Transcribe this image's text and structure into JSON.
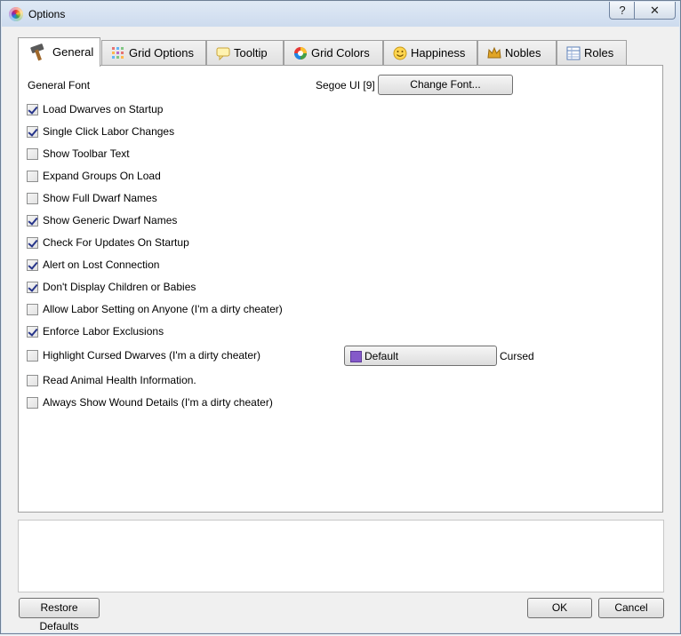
{
  "window": {
    "title": "Options",
    "help_glyph": "?",
    "close_glyph": "✕"
  },
  "tabs": [
    {
      "label": "General",
      "icon": "hammer-icon"
    },
    {
      "label": "Grid Options",
      "icon": "grid-dots-icon"
    },
    {
      "label": "Tooltip",
      "icon": "tooltip-icon"
    },
    {
      "label": "Grid Colors",
      "icon": "color-wheel-icon"
    },
    {
      "label": "Happiness",
      "icon": "smiley-icon"
    },
    {
      "label": "Nobles",
      "icon": "crown-icon"
    },
    {
      "label": "Roles",
      "icon": "table-icon"
    }
  ],
  "general": {
    "font_label": "General Font",
    "font_value": "Segoe UI [9]",
    "change_font_label": "Change Font...",
    "options": [
      {
        "label": "Load Dwarves on Startup",
        "checked": true
      },
      {
        "label": "Single Click Labor Changes",
        "checked": true
      },
      {
        "label": "Show Toolbar Text",
        "checked": false
      },
      {
        "label": "Expand Groups On Load",
        "checked": false
      },
      {
        "label": "Show Full Dwarf Names",
        "checked": false
      },
      {
        "label": "Show Generic Dwarf Names",
        "checked": true
      },
      {
        "label": "Check For Updates On Startup",
        "checked": true
      },
      {
        "label": "Alert on Lost Connection",
        "checked": true
      },
      {
        "label": "Don't Display Children or Babies",
        "checked": true
      },
      {
        "label": "Allow Labor Setting on Anyone (I'm a dirty cheater)",
        "checked": false
      },
      {
        "label": "Enforce Labor Exclusions",
        "checked": true
      },
      {
        "label": "Highlight Cursed Dwarves (I'm a dirty cheater)",
        "checked": false
      },
      {
        "label": "Read Animal Health Information.",
        "checked": false
      },
      {
        "label": "Always Show Wound Details (I'm a dirty cheater)",
        "checked": false
      }
    ],
    "cursed_color": {
      "button_label": "Default",
      "swatch": "#8459c9",
      "caption": "Cursed"
    }
  },
  "footer": {
    "restore_label": "Restore Defaults",
    "ok_label": "OK",
    "cancel_label": "Cancel"
  }
}
